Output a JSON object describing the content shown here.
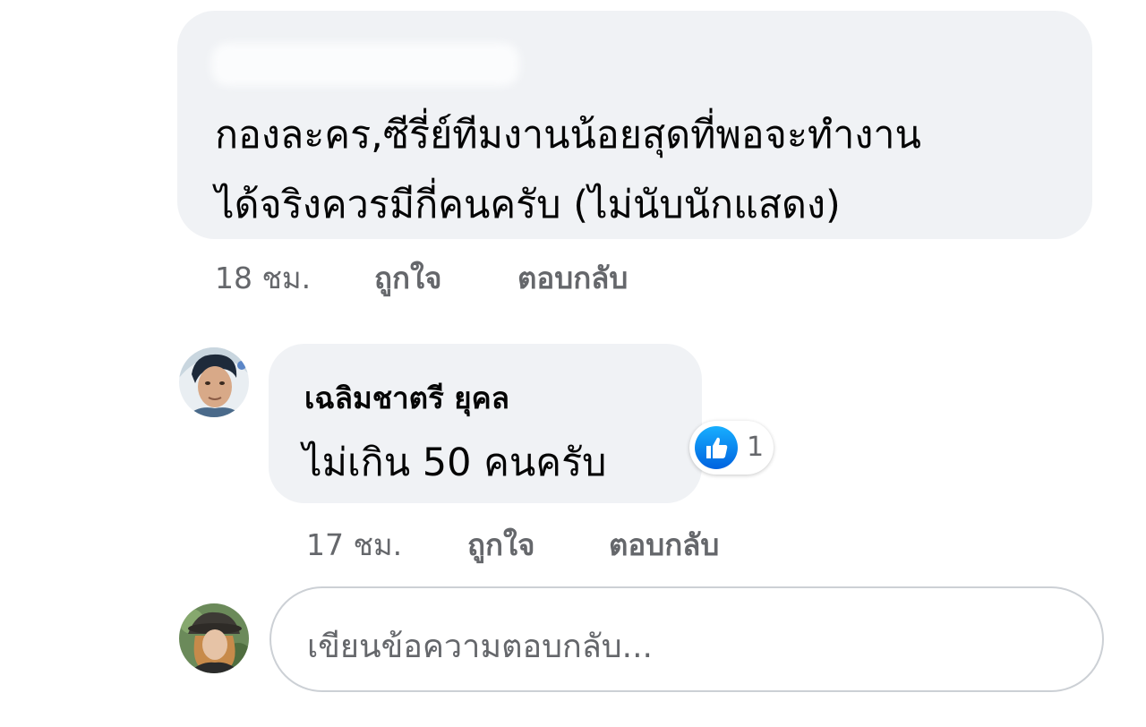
{
  "comment": {
    "author_name": "",
    "text_line1": "กองละคร,ซีรี่ย์ทีมงานน้อยสุดที่พอจะทำงาน",
    "text_line2": "ได้จริงควรมีกี่คนครับ (ไม่นับนักแสดง)",
    "time": "18 ชม.",
    "like_label": "ถูกใจ",
    "reply_label": "ตอบกลับ"
  },
  "reply": {
    "author_name": "เฉลิมชาตรี ยุคล",
    "text": "ไม่เกิน 50 คนครับ",
    "time": "17 ชม.",
    "like_label": "ถูกใจ",
    "reply_label": "ตอบกลับ",
    "reaction_icon": "like-icon",
    "reaction_count": "1"
  },
  "composer": {
    "placeholder": "เขียนข้อความตอบกลับ..."
  },
  "colors": {
    "bubble": "#f0f2f5",
    "meta_text": "#65676b",
    "like_blue": "#1877f2",
    "input_border": "#ccd0d5"
  }
}
